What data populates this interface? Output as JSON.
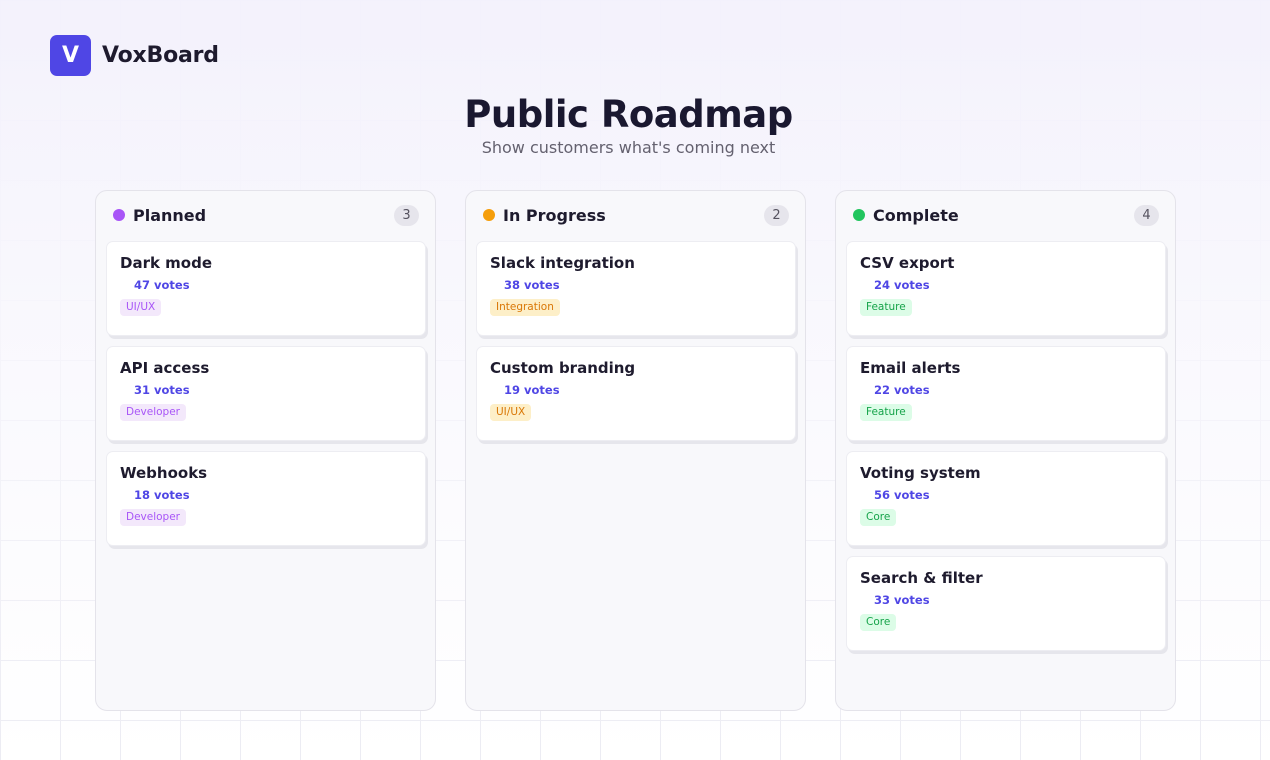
{
  "brand": {
    "logo_letter": "V",
    "name": "VoxBoard",
    "accent": "#4f46e5"
  },
  "header": {
    "title": "Public Roadmap",
    "subtitle": "Show customers what's coming next"
  },
  "columns": [
    {
      "title": "Planned",
      "count": "3",
      "dot_color": "#a855f7",
      "cards": [
        {
          "title": "Dark mode",
          "votes": "47 votes",
          "tag": "UI/UX",
          "tag_bg": "#f3e8fb",
          "tag_color": "#a855f7"
        },
        {
          "title": "API access",
          "votes": "31 votes",
          "tag": "Developer",
          "tag_bg": "#f3e8fb",
          "tag_color": "#a855f7"
        },
        {
          "title": "Webhooks",
          "votes": "18 votes",
          "tag": "Developer",
          "tag_bg": "#f3e8fb",
          "tag_color": "#a855f7"
        }
      ]
    },
    {
      "title": "In Progress",
      "count": "2",
      "dot_color": "#f59e0b",
      "cards": [
        {
          "title": "Slack integration",
          "votes": "38 votes",
          "tag": "Integration",
          "tag_bg": "#fdefc8",
          "tag_color": "#d97706"
        },
        {
          "title": "Custom branding",
          "votes": "19 votes",
          "tag": "UI/UX",
          "tag_bg": "#fdefc8",
          "tag_color": "#d97706"
        }
      ]
    },
    {
      "title": "Complete",
      "count": "4",
      "dot_color": "#22c55e",
      "cards": [
        {
          "title": "CSV export",
          "votes": "24 votes",
          "tag": "Feature",
          "tag_bg": "#dcfce7",
          "tag_color": "#16a34a"
        },
        {
          "title": "Email alerts",
          "votes": "22 votes",
          "tag": "Feature",
          "tag_bg": "#dcfce7",
          "tag_color": "#16a34a"
        },
        {
          "title": "Voting system",
          "votes": "56 votes",
          "tag": "Core",
          "tag_bg": "#dcfce7",
          "tag_color": "#16a34a"
        },
        {
          "title": "Search & filter",
          "votes": "33 votes",
          "tag": "Core",
          "tag_bg": "#dcfce7",
          "tag_color": "#16a34a"
        }
      ]
    }
  ],
  "icons": {
    "vote": "upvote-icon"
  }
}
